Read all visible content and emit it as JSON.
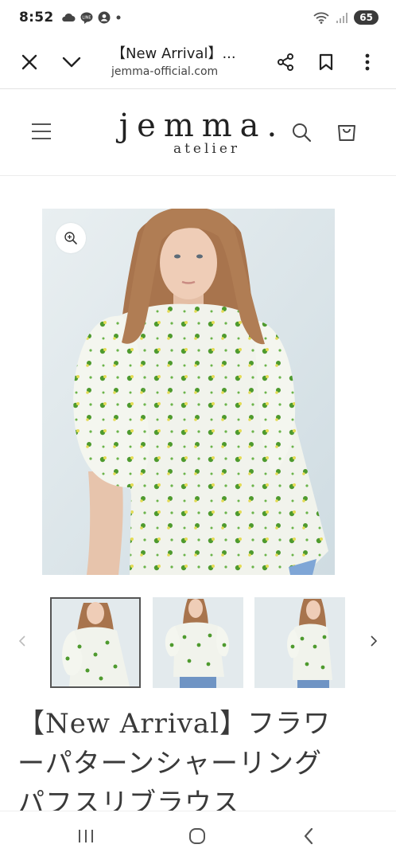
{
  "status_bar": {
    "time": "8:52",
    "battery": "65",
    "icons": [
      "cloud-icon",
      "line-icon",
      "account-icon",
      "dot-icon",
      "wifi-icon",
      "signal-icon"
    ]
  },
  "browser": {
    "title": "【New Arrival】...",
    "url": "jemma-official.com",
    "icons": [
      "close-icon",
      "chevron-down-icon",
      "share-icon",
      "bookmark-icon",
      "more-vert-icon"
    ]
  },
  "site": {
    "logo_main": "jemma.",
    "logo_sub": "atelier",
    "icons": [
      "menu-icon",
      "search-icon",
      "cart-icon"
    ]
  },
  "product": {
    "title_line1": "【New Arrival】フラワ",
    "title_line2": "ーパターンシャーリング",
    "title_line3": "パフスリブラウス",
    "thumbnail_count": 3,
    "active_thumbnail": 1
  },
  "colors": {
    "accent_green": "#4e9a2e",
    "flower_yellow": "#e4dc55",
    "blouse": "#f1f3ec",
    "backdrop": "#dde6ea"
  },
  "nav": {
    "icons": [
      "recents-icon",
      "home-icon",
      "back-icon"
    ]
  }
}
